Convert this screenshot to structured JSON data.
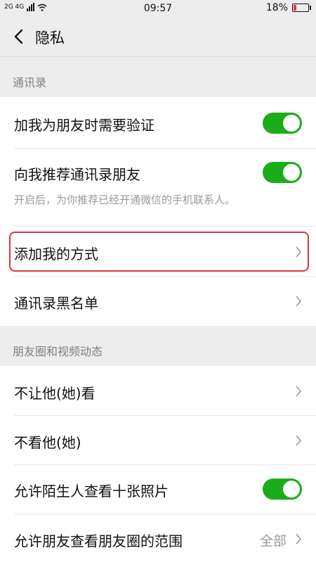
{
  "status_bar": {
    "left_text": "2G 4G",
    "time": "09:57",
    "battery_percent_text": "18%",
    "battery_level": 0.18,
    "battery_color": "#e53935"
  },
  "nav": {
    "back_icon": "chevron-left-icon",
    "title": "隐私"
  },
  "sections": {
    "contacts": {
      "header": "通讯录",
      "items": [
        {
          "label": "加我为朋友时需要验证",
          "control": "toggle",
          "on": true
        },
        {
          "label": "向我推荐通讯录朋友",
          "control": "toggle",
          "on": true,
          "hint": "开启后，为你推荐已经开通微信的手机联系人。"
        },
        {
          "label": "添加我的方式",
          "control": "chevron"
        },
        {
          "label": "通讯录黑名单",
          "control": "chevron"
        }
      ]
    },
    "moments": {
      "header": "朋友圈和视频动态",
      "items": [
        {
          "label": "不让他(她)看",
          "control": "chevron"
        },
        {
          "label": "不看他(她)",
          "control": "chevron"
        },
        {
          "label": "允许陌生人查看十张照片",
          "control": "toggle",
          "on": true
        },
        {
          "label": "允许朋友查看朋友圈的范围",
          "control": "chevron",
          "value": "全部"
        }
      ]
    }
  },
  "colors": {
    "toggle_on": "#1aad19",
    "highlight_border": "#d33a3a",
    "background": "#ededed"
  }
}
